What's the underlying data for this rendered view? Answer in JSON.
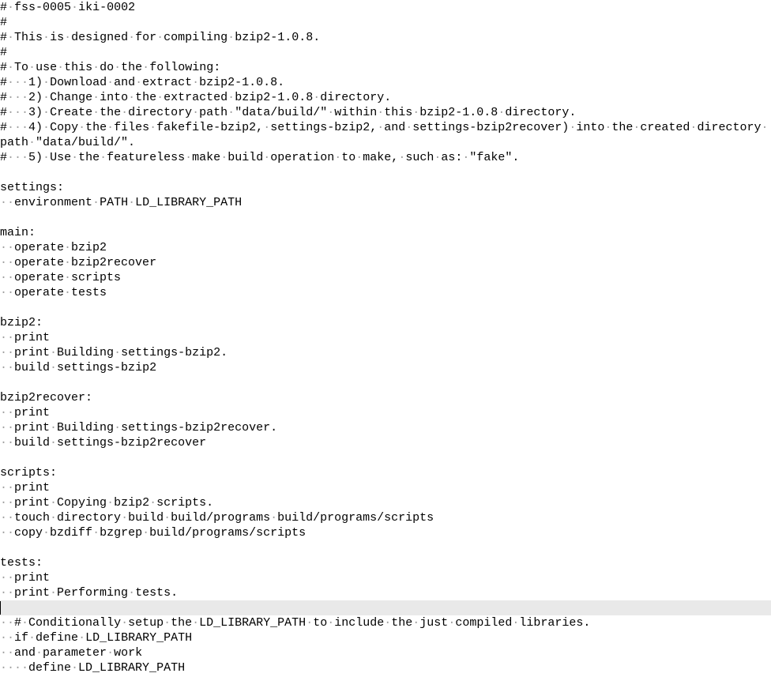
{
  "dot": "·",
  "lines": [
    {
      "indent": "#",
      "ws": " ",
      "text": "fss-0005 iki-0002"
    },
    {
      "indent": "#",
      "ws": "",
      "text": ""
    },
    {
      "indent": "#",
      "ws": " ",
      "text": "This is designed for compiling bzip2-1.0.8."
    },
    {
      "indent": "#",
      "ws": "",
      "text": ""
    },
    {
      "indent": "#",
      "ws": " ",
      "text": "To use this do the following:"
    },
    {
      "indent": "#",
      "ws": "   ",
      "text": "1) Download and extract bzip2-1.0.8."
    },
    {
      "indent": "#",
      "ws": "   ",
      "text": "2) Change into the extracted bzip2-1.0.8 directory."
    },
    {
      "indent": "#",
      "ws": "   ",
      "text": "3) Create the directory path \"data/build/\" within this bzip2-1.0.8 directory."
    },
    {
      "indent": "#",
      "ws": "   ",
      "text": "4) Copy the files fakefile-bzip2, settings-bzip2, and settings-bzip2recover) into the created directory path \"data/build/\"."
    },
    {
      "indent": "#",
      "ws": "   ",
      "text": "5) Use the featureless make build operation to make, such as: \"fake\"."
    },
    {
      "indent": "",
      "ws": "",
      "text": ""
    },
    {
      "indent": "",
      "ws": "",
      "text": "settings:"
    },
    {
      "indent": "",
      "ws": "  ",
      "text": "environment PATH LD_LIBRARY_PATH"
    },
    {
      "indent": "",
      "ws": "",
      "text": ""
    },
    {
      "indent": "",
      "ws": "",
      "text": "main:"
    },
    {
      "indent": "",
      "ws": "  ",
      "text": "operate bzip2"
    },
    {
      "indent": "",
      "ws": "  ",
      "text": "operate bzip2recover"
    },
    {
      "indent": "",
      "ws": "  ",
      "text": "operate scripts"
    },
    {
      "indent": "",
      "ws": "  ",
      "text": "operate tests"
    },
    {
      "indent": "",
      "ws": "",
      "text": ""
    },
    {
      "indent": "",
      "ws": "",
      "text": "bzip2:"
    },
    {
      "indent": "",
      "ws": "  ",
      "text": "print"
    },
    {
      "indent": "",
      "ws": "  ",
      "text": "print Building settings-bzip2."
    },
    {
      "indent": "",
      "ws": "  ",
      "text": "build settings-bzip2"
    },
    {
      "indent": "",
      "ws": "",
      "text": ""
    },
    {
      "indent": "",
      "ws": "",
      "text": "bzip2recover:"
    },
    {
      "indent": "",
      "ws": "  ",
      "text": "print"
    },
    {
      "indent": "",
      "ws": "  ",
      "text": "print Building settings-bzip2recover."
    },
    {
      "indent": "",
      "ws": "  ",
      "text": "build settings-bzip2recover"
    },
    {
      "indent": "",
      "ws": "",
      "text": ""
    },
    {
      "indent": "",
      "ws": "",
      "text": "scripts:"
    },
    {
      "indent": "",
      "ws": "  ",
      "text": "print"
    },
    {
      "indent": "",
      "ws": "  ",
      "text": "print Copying bzip2 scripts."
    },
    {
      "indent": "",
      "ws": "  ",
      "text": "touch directory build build/programs build/programs/scripts"
    },
    {
      "indent": "",
      "ws": "  ",
      "text": "copy bzdiff bzgrep build/programs/scripts"
    },
    {
      "indent": "",
      "ws": "",
      "text": ""
    },
    {
      "indent": "",
      "ws": "",
      "text": "tests:"
    },
    {
      "indent": "",
      "ws": "  ",
      "text": "print"
    },
    {
      "indent": "",
      "ws": "  ",
      "text": "print Performing tests."
    },
    {
      "indent": "",
      "ws": "",
      "text": "",
      "highlight": true,
      "cursor": true
    },
    {
      "indent": "",
      "ws": "  ",
      "text": "# Conditionally setup the LD_LIBRARY_PATH to include the just compiled libraries."
    },
    {
      "indent": "",
      "ws": "  ",
      "text": "if define LD_LIBRARY_PATH"
    },
    {
      "indent": "",
      "ws": "  ",
      "text": "and parameter work"
    },
    {
      "indent": "",
      "ws": "    ",
      "text": "define LD_LIBRARY_PATH"
    }
  ]
}
